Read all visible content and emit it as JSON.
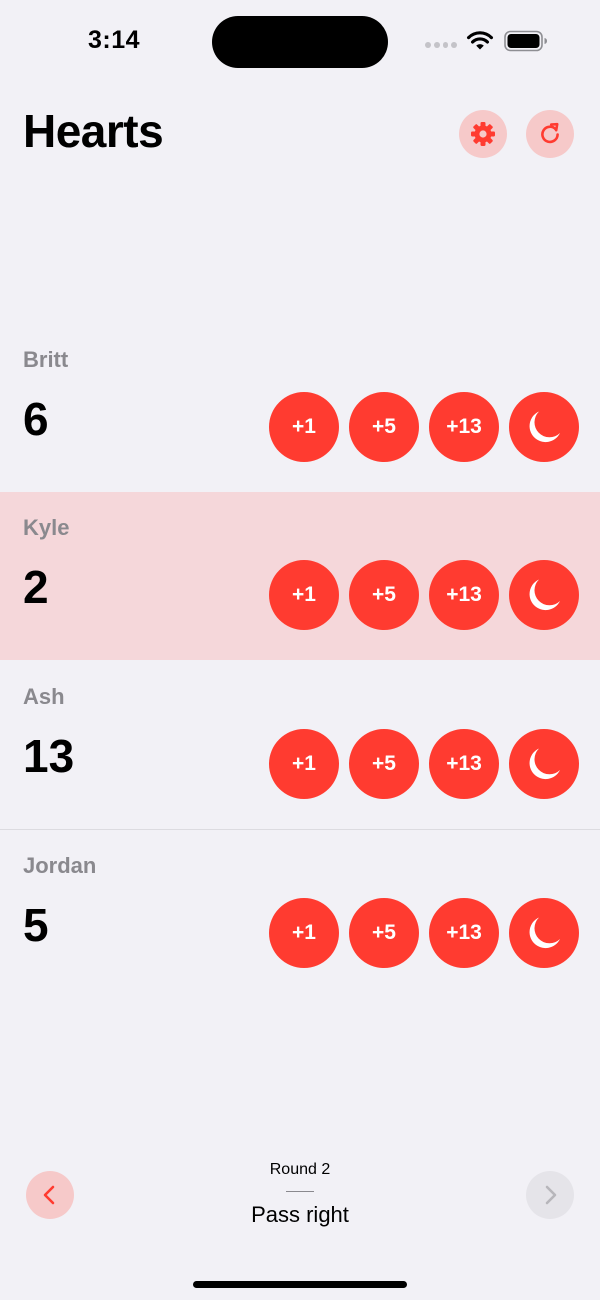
{
  "status_bar": {
    "time": "3:14",
    "icons": [
      "signal-icon",
      "wifi-icon",
      "battery-icon"
    ]
  },
  "header": {
    "title": "Hearts",
    "settings_icon": "gear-icon",
    "reset_icon": "refresh-icon"
  },
  "players": [
    {
      "name": "Britt",
      "score": "6",
      "current": false
    },
    {
      "name": "Kyle",
      "score": "2",
      "current": true
    },
    {
      "name": "Ash",
      "score": "13",
      "current": false
    },
    {
      "name": "Jordan",
      "score": "5",
      "current": false
    }
  ],
  "score_buttons": {
    "plus1": "+1",
    "plus5": "+5",
    "plus13": "+13",
    "moon_icon": "moon-icon"
  },
  "footer": {
    "round": "Round 2",
    "pass": "Pass right",
    "prev_icon": "chevron-left-icon",
    "next_icon": "chevron-right-icon"
  },
  "colors": {
    "accent": "#ff3b30",
    "accent_soft": "#f6c9c9",
    "current_row": "#f5d7da",
    "background": "#f2f1f6",
    "secondary_text": "#8a898e"
  }
}
